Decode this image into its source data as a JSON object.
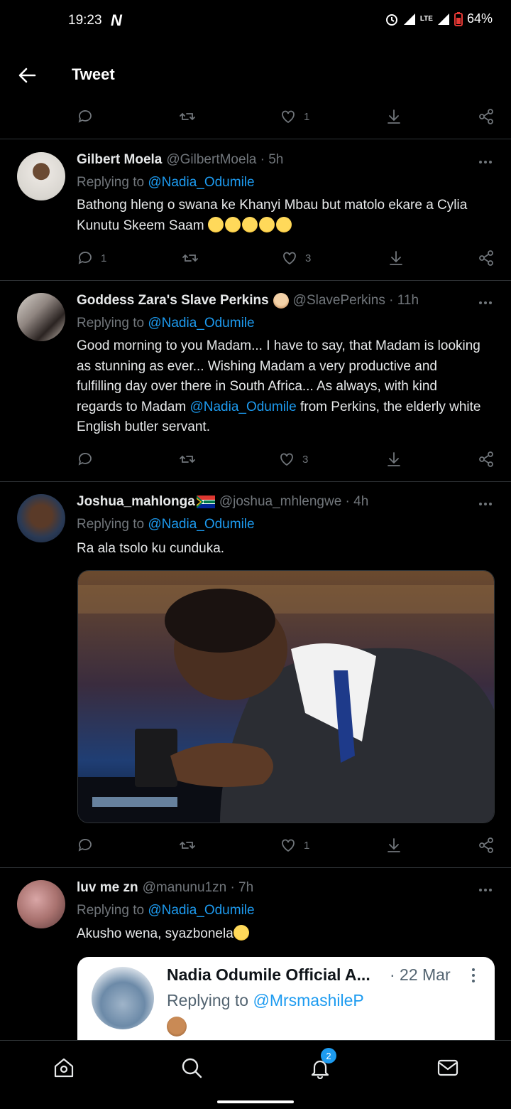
{
  "status_bar": {
    "time": "19:23",
    "notification_glyph": "N",
    "battery": "64%",
    "network": "LTE"
  },
  "header": {
    "title": "Tweet"
  },
  "top_actions": {
    "like_count": "1"
  },
  "tweets": [
    {
      "name": "Gilbert Moela",
      "handle_time": "@GilbertMoela · 5h",
      "replying_prefix": "Replying to ",
      "replying_to": "@Nadia_Odumile",
      "text": "Bathong hleng o swana ke Khanyi Mbau but matolo ekare a Cylia Kunutu Skeem Saam",
      "reply_count": "1",
      "like_count": "3"
    },
    {
      "name": "Goddess Zara's Slave Perkins",
      "handle_time": "@SlavePerkins · 11h",
      "replying_prefix": "Replying to ",
      "replying_to": "@Nadia_Odumile",
      "text_before": "Good morning to you Madam... I have to say, that Madam is looking as stunning as ever... Wishing Madam a very productive and fulfilling day over there in South Africa... As always, with kind regards to Madam ",
      "text_mention": "@Nadia_Odumile",
      "text_after": " from Perkins, the elderly white English butler servant.",
      "like_count": "3"
    },
    {
      "name": "Joshua_mahlonga",
      "handle_time": "@joshua_mhlengwe · 4h",
      "replying_prefix": "Replying to ",
      "replying_to": "@Nadia_Odumile",
      "text": "Ra ala tsolo ku cunduka.",
      "like_count": "1"
    },
    {
      "name": "luv me zn",
      "handle_time": "@manunu1zn · 7h",
      "replying_prefix": "Replying to ",
      "replying_to": "@Nadia_Odumile",
      "text": "Akusho wena, syazbonela",
      "quote": {
        "name": "Nadia Odumile Official A...",
        "date": "· 22 Mar",
        "replying_prefix": "Replying to ",
        "replying_to": "@MrsmashileP"
      }
    }
  ],
  "bottom_nav": {
    "notification_badge": "2"
  },
  "colors": {
    "accent": "#1d9bf0",
    "muted": "#71767b",
    "background": "#000000"
  },
  "icons": [
    "back-arrow-icon",
    "reply-icon",
    "retweet-icon",
    "heart-icon",
    "download-icon",
    "share-icon",
    "more-icon",
    "home-icon",
    "search-icon",
    "bell-icon",
    "mail-icon"
  ]
}
